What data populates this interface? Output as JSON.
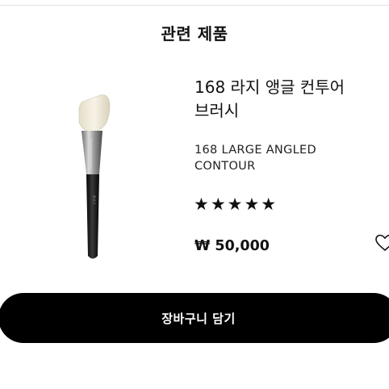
{
  "related": {
    "title": "관련 제품"
  },
  "product": {
    "name_ko": "168 라지 앵글 컨투어 브러시",
    "name_en": "168 LARGE ANGLED CONTOUR",
    "stars": "★★★★★",
    "rating": 5,
    "rating_max": 5,
    "price": "₩ 50,000",
    "image_icon": "angled-brush-image",
    "wishlist_icon": "heart-outline-icon"
  },
  "cart": {
    "button_label": "장바구니 담기"
  },
  "colors": {
    "button_bg": "#000000",
    "button_text": "#ffffff",
    "text": "#111111"
  }
}
